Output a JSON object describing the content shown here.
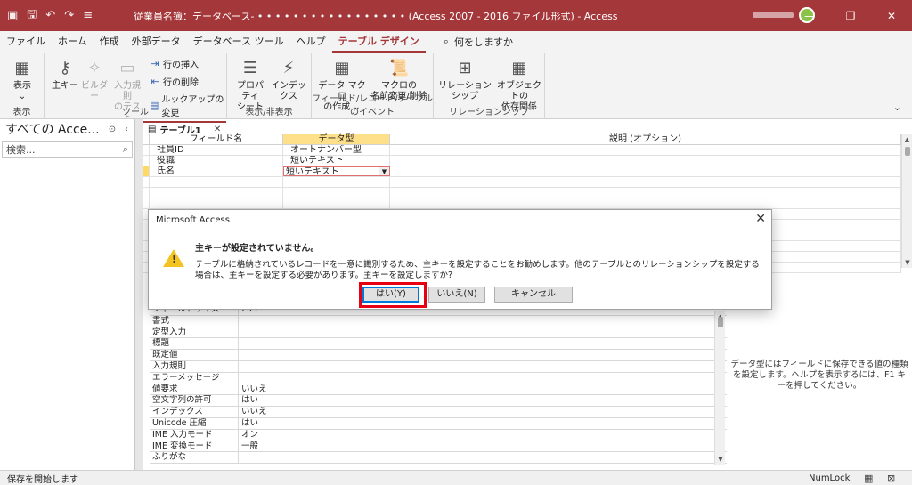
{
  "window": {
    "title": "従業員名簿：データベース- • • • • • • • • • • • • • • • • • (Access 2007 - 2016 ファイル形式) - Access",
    "minimize_glyph": "—",
    "restore_glyph": "❐",
    "close_glyph": "✕"
  },
  "menu": {
    "tabs": [
      "ファイル",
      "ホーム",
      "作成",
      "外部データ",
      "データベース ツール",
      "ヘルプ",
      "テーブル デザイン"
    ],
    "active_tab": "テーブル デザイン",
    "tell_me": "何をしますか"
  },
  "ribbon": {
    "groups": {
      "view": "表示",
      "tools": "ツール",
      "show_hide": "表示/非表示",
      "events": "フィールド/レコード/テーブルのイベント",
      "relationships": "リレーションシップ"
    },
    "buttons": {
      "view": "表示",
      "primary_key": "主キー",
      "builder": "ビルダー",
      "test_rule_1": "入力規則",
      "test_rule_2": "のテスト",
      "insert_row": "行の挿入",
      "delete_row": "行の削除",
      "lookup": "ルックアップの変更",
      "property_sheet_1": "プロパティ",
      "property_sheet_2": "シート",
      "indexes": "インデックス",
      "data_macro_1": "データ マクロ",
      "data_macro_2": "の作成 ⌄",
      "rename_macro_1": "マクロの",
      "rename_macro_2": "名前変更/削除",
      "relationships": "リレーションシップ",
      "dependencies_1": "オブジェクトの",
      "dependencies_2": "依存関係"
    }
  },
  "nav": {
    "title": "すべての Acce...",
    "search_placeholder": "検索..."
  },
  "document": {
    "tab_label": "テーブル1",
    "columns": [
      "フィールド名",
      "データ型",
      "説明 (オプション)"
    ],
    "rows": [
      {
        "field": "社員ID",
        "type": "オートナンバー型"
      },
      {
        "field": "役職",
        "type": "短いテキスト"
      },
      {
        "field": "氏名",
        "type": "短いテキスト"
      }
    ]
  },
  "properties": {
    "rows": [
      {
        "label": "フィールドサイズ",
        "value": "255"
      },
      {
        "label": "書式",
        "value": ""
      },
      {
        "label": "定型入力",
        "value": ""
      },
      {
        "label": "標題",
        "value": ""
      },
      {
        "label": "既定値",
        "value": ""
      },
      {
        "label": "入力規則",
        "value": ""
      },
      {
        "label": "エラーメッセージ",
        "value": ""
      },
      {
        "label": "値要求",
        "value": "いいえ"
      },
      {
        "label": "空文字列の許可",
        "value": "はい"
      },
      {
        "label": "インデックス",
        "value": "いいえ"
      },
      {
        "label": "Unicode 圧縮",
        "value": "はい"
      },
      {
        "label": "IME 入力モード",
        "value": "オン"
      },
      {
        "label": "IME 変換モード",
        "value": "一般"
      },
      {
        "label": "ふりがな",
        "value": ""
      }
    ],
    "help": "データ型にはフィールドに保存できる値の種類を設定します。ヘルプを表示するには、F1 キーを押してください。"
  },
  "dialog": {
    "title": "Microsoft Access",
    "heading": "主キーが設定されていません。",
    "message": "テーブルに格納されているレコードを一意に識別するため、主キーを設定することをお勧めします。他のテーブルとのリレーションシップを設定する場合は、主キーを設定する必要があります。主キーを設定しますか?",
    "yes": "はい(Y)",
    "no": "いいえ(N)",
    "cancel": "キャンセル"
  },
  "status": {
    "text": "保存を開始します",
    "numlock": "NumLock"
  }
}
